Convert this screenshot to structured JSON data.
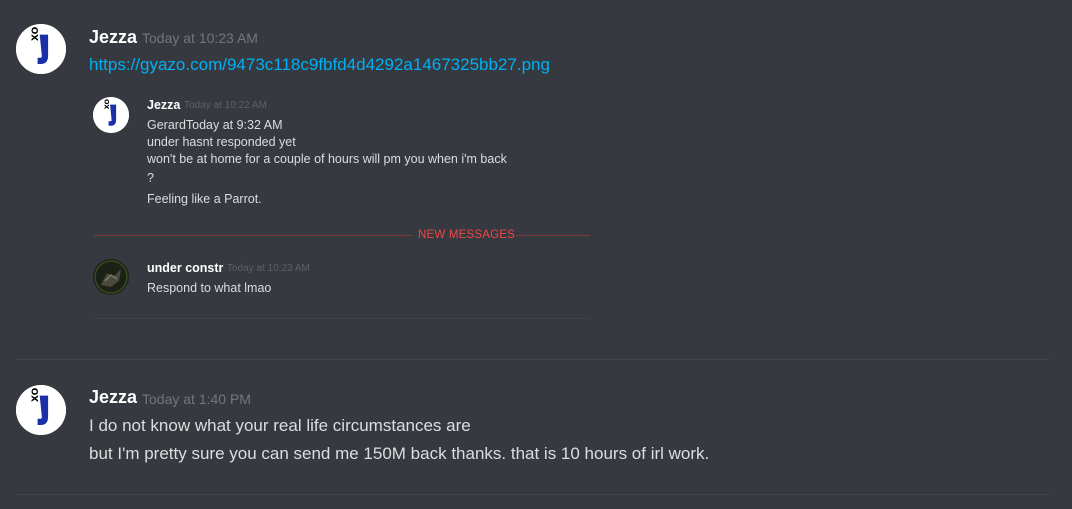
{
  "messages": [
    {
      "author": "Jezza",
      "timestamp": "Today at 10:23 AM",
      "link": "https://gyazo.com/9473c118c9fbfd4d4292a1467325bb27.png",
      "embed": {
        "original": {
          "author": "Jezza",
          "timestamp": "Today at 10:22 AM",
          "lines": [
            "GerardToday at 9:32 AM",
            "under hasnt responded yet",
            "won't be at home for a couple of hours will pm you when i'm back",
            "?",
            "Feeling like a Parrot."
          ]
        },
        "new_messages_label": "NEW MESSAGES",
        "reply": {
          "author": "under constr",
          "timestamp": "Today at 10:23 AM",
          "text": "Respond to what lmao"
        }
      }
    },
    {
      "author": "Jezza",
      "timestamp": "Today at 1:40 PM",
      "lines": [
        "I do not know what your real life circumstances are",
        "but I'm pretty sure you can send me 150M back thanks. that is 10 hours of irl work."
      ]
    }
  ],
  "colors": {
    "background": "#36393f",
    "username": "#ffffff",
    "text": "#dcddde",
    "timestamp": "#72767d",
    "link": "#00b0f4",
    "new_messages": "#f04747",
    "avatar_letter": "#1a2fa8"
  }
}
